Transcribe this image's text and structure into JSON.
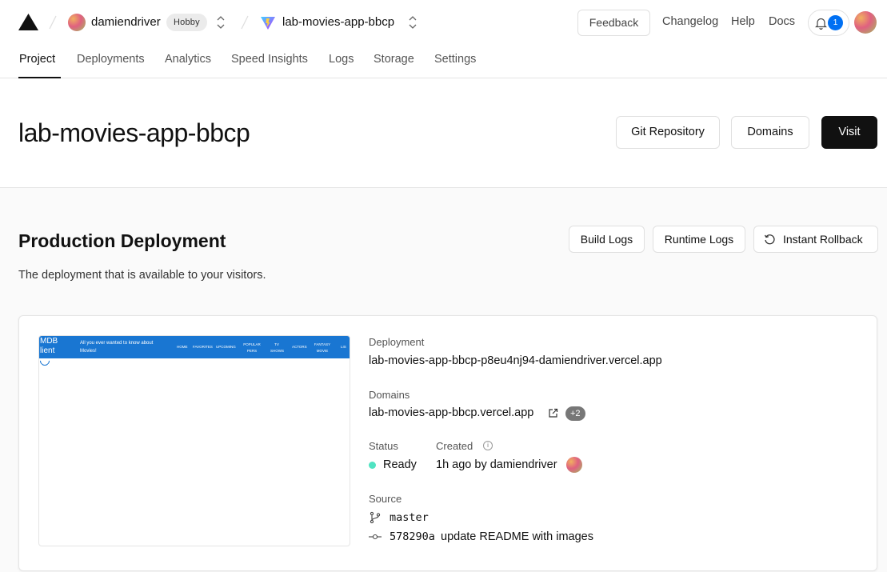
{
  "topbar": {
    "team_name": "damiendriver",
    "plan_badge": "Hobby",
    "project_name": "lab-movies-app-bbcp",
    "feedback_label": "Feedback",
    "changelog_label": "Changelog",
    "help_label": "Help",
    "docs_label": "Docs",
    "notification_count": "1"
  },
  "tabs": [
    {
      "label": "Project",
      "active": true
    },
    {
      "label": "Deployments"
    },
    {
      "label": "Analytics"
    },
    {
      "label": "Speed Insights"
    },
    {
      "label": "Logs"
    },
    {
      "label": "Storage"
    },
    {
      "label": "Settings"
    }
  ],
  "header": {
    "title": "lab-movies-app-bbcp",
    "git_repository_label": "Git Repository",
    "domains_label": "Domains",
    "visit_label": "Visit"
  },
  "production": {
    "title": "Production Deployment",
    "description": "The deployment that is available to your visitors.",
    "build_logs_label": "Build Logs",
    "runtime_logs_label": "Runtime Logs",
    "instant_rollback_label": "Instant Rollback"
  },
  "preview": {
    "logo_text": "MDB lient",
    "tagline": "All you ever wanted to know about Movies!",
    "nav": [
      "HOME",
      "FAVORITES",
      "UPCOMING",
      "POPULAR PERS",
      "TV SHOWS",
      "ACTORS",
      "FANTASY MOVIE",
      "LIS"
    ],
    "bar_color": "#1976d2"
  },
  "deployment": {
    "deployment_label": "Deployment",
    "deployment_url": "lab-movies-app-bbcp-p8eu4nj94-damiendriver.vercel.app",
    "domains_label": "Domains",
    "domain": "lab-movies-app-bbcp.vercel.app",
    "extra_domains": "+2",
    "status_label": "Status",
    "status_value": "Ready",
    "status_color": "#50e3c2",
    "created_label": "Created",
    "created_value": "1h ago by damiendriver",
    "source_label": "Source",
    "branch": "master",
    "commit_hash": "578290a",
    "commit_message": "update README with images"
  }
}
